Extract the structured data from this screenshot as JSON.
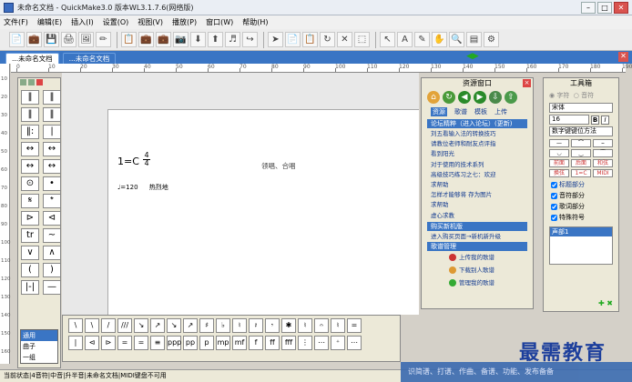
{
  "window": {
    "title": "未命名文档 - QuickMake3.0 版本WL3.1.7.6(网络版)"
  },
  "menu": [
    "文件(F)",
    "编辑(E)",
    "插入(I)",
    "设置(O)",
    "视图(V)",
    "播放(P)",
    "窗口(W)",
    "帮助(H)"
  ],
  "toolbar": [
    "📄",
    "💼",
    "💾",
    "🖨",
    "🖼",
    "✏",
    "📋",
    "💼",
    "💼",
    "📷",
    "⬇",
    "⬆",
    "♬",
    "↪",
    "➤",
    "📄",
    "📋",
    "↻",
    "✕",
    "⬚",
    "↖",
    "A",
    "✎",
    "✋",
    "🔍",
    "▤",
    "⚙"
  ],
  "tabs": [
    {
      "label": "...未命名文档",
      "active": true
    },
    {
      "label": "...未命名文档",
      "active": false
    }
  ],
  "ruler_ticks": [
    "0",
    "10",
    "20",
    "30",
    "40",
    "50",
    "60",
    "70",
    "80",
    "90",
    "100",
    "110",
    "120",
    "130",
    "140",
    "150",
    "160",
    "170",
    "180",
    "190"
  ],
  "vruler_ticks": [
    "10",
    "20",
    "30",
    "40",
    "50",
    "60",
    "70",
    "80",
    "90",
    "100",
    "110",
    "120",
    "130",
    "140",
    "150",
    "160"
  ],
  "left_symbols": [
    "‖",
    "‖",
    "‖",
    "‖",
    "‖:",
    "|",
    "↔",
    "↔",
    "↔",
    "↔",
    "⊙",
    "•",
    "𝄋",
    "𝄌",
    "⊳",
    "⊲",
    "tr",
    "~",
    "∨",
    "∧",
    "(",
    ")",
    "|-|",
    "—"
  ],
  "left_list": [
    {
      "label": "通用",
      "selected": true
    },
    {
      "label": "曲子",
      "selected": false
    },
    {
      "label": "一组",
      "selected": false
    }
  ],
  "score": {
    "key": "1=C",
    "time_top": "4",
    "time_bottom": "4",
    "tempo": "♩=120",
    "tempo_text": "热烈地",
    "subtitle": "领唱、合唱"
  },
  "resource": {
    "title": "资源窗口",
    "tabs": [
      {
        "label": "资源",
        "on": true
      },
      {
        "label": "歌谱",
        "on": false
      },
      {
        "label": "模板",
        "on": false
      },
      {
        "label": "上传",
        "on": false
      }
    ],
    "forum_bar": "论坛精粹（进入论坛）(更新)",
    "items": [
      "刘五看输入法的转换技巧",
      "请教位老师和耐友点评指",
      "看到阳光",
      "对于使用的技术系列",
      "高级技巧练习之七：欢迎",
      "求帮助",
      "怎样才能够将 存为图片",
      "求帮助",
      "虚心求教"
    ],
    "buy_bar": "购买新机版",
    "buy_link": "进入购买页面→新机新升级",
    "song_bar": "歌谱管理",
    "song_items": [
      "上传我的歌谱",
      "下载别人歌谱",
      "管理我的歌谱"
    ]
  },
  "toolbox": {
    "title": "工具箱",
    "radio1": "字符",
    "radio2": "音符",
    "font": "宋体",
    "size": "16",
    "bold": "B",
    "italic": "I",
    "keyboard": "数字键键位方法",
    "buttons": [
      "—",
      "⌒",
      "⌣",
      "◡",
      "‿",
      "⁀",
      "前面",
      "后面",
      "和弦",
      "换弦",
      "1=C",
      "MIDI"
    ],
    "checks": [
      "标题部分",
      "音符部分",
      "歌词部分",
      "特殊符号"
    ],
    "list": [
      "声部1"
    ]
  },
  "bottom_row1": [
    "\\",
    "\\",
    "/",
    "///",
    "↘",
    "↗",
    "↘",
    "↗",
    "♯",
    "♭",
    "♮",
    "𝄽",
    "𝄾",
    "✱",
    "♮",
    "𝄐",
    "♮",
    "="
  ],
  "bottom_row2": [
    "|",
    "⊲",
    "⊳",
    "=",
    "=",
    "≡",
    "ppp",
    "pp",
    "p",
    "mp",
    "mf",
    "f",
    "ff",
    "fff",
    "⋮",
    "⋯",
    "⁺",
    "⋯"
  ],
  "status": "当前状态|4音符|中音|升半音|未命名文档|MIDI键盘不可用",
  "banner": "识简谱、打谱、作曲、备谱、功能、发布备备",
  "watermark": "最需教育"
}
